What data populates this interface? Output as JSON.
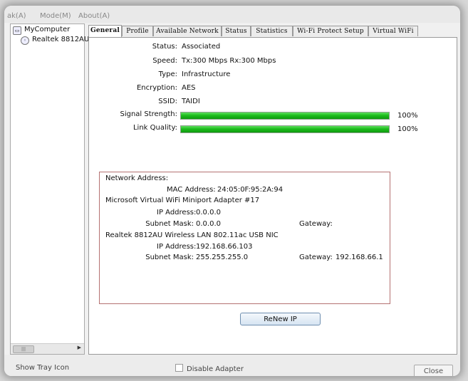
{
  "menu": {
    "items": [
      "ak(A)",
      "Mode(M)",
      "About(A)"
    ]
  },
  "tree": {
    "root": "MyComputer",
    "child": "Realtek 8812AU"
  },
  "tabs": [
    "General",
    "Profile",
    "Available Network",
    "Status",
    "Statistics",
    "Wi-Fi Protect Setup",
    "Virtual WiFi"
  ],
  "general": {
    "status_label": "Status:",
    "status": "Associated",
    "speed_label": "Speed:",
    "speed": "Tx:300 Mbps Rx:300 Mbps",
    "type_label": "Type:",
    "type": "Infrastructure",
    "encryption_label": "Encryption:",
    "encryption": "AES",
    "ssid_label": "SSID:",
    "ssid": "TAIDI",
    "signal_label": "Signal Strength:",
    "signal_text": "100%",
    "signal_value": 100,
    "link_label": "Link Quality:",
    "link_text": "100%",
    "link_value": 100
  },
  "network": {
    "title": "Network Address:",
    "mac_label": "MAC Address:",
    "mac": "24:05:0F:95:2A:94",
    "adapter1": "Microsoft Virtual WiFi Miniport Adapter #17",
    "ip1_label": "IP Address:",
    "ip1": "0.0.0.0",
    "mask1_label": "Subnet Mask:",
    "mask1": "0.0.0.0",
    "gw1_label": "Gateway:",
    "gw1": "",
    "adapter2": "Realtek 8812AU Wireless LAN 802.11ac USB NIC",
    "ip2_label": "IP Address:",
    "ip2": "192.168.66.103",
    "mask2_label": "Subnet Mask:",
    "mask2": "255.255.255.0",
    "gw2_label": "Gateway:",
    "gw2": "192.168.66.1"
  },
  "buttons": {
    "renew": "ReNew IP",
    "close": "Close"
  },
  "footer": {
    "tray": "Show Tray Icon",
    "disable": "Disable Adapter"
  },
  "colors": {
    "bar_green": "#11b011",
    "netbox_border": "#b47272"
  }
}
